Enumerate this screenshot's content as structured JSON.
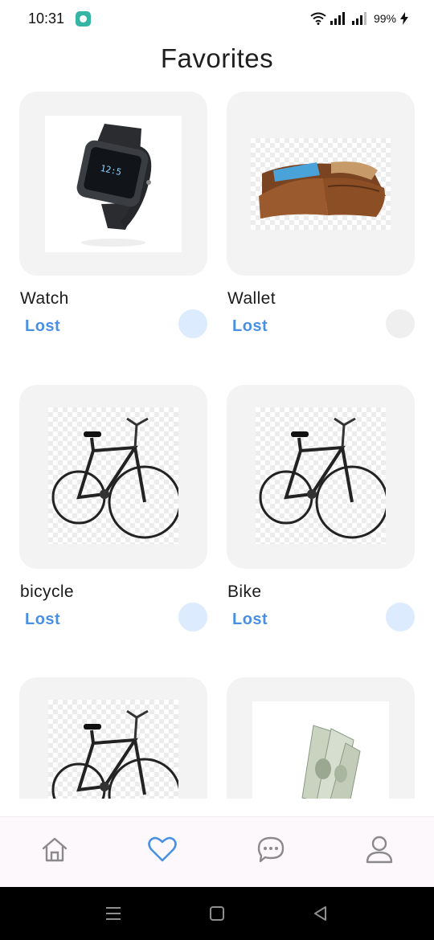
{
  "status_bar": {
    "time": "10:31",
    "battery": "99%"
  },
  "header": {
    "title": "Favorites"
  },
  "items": [
    {
      "name": "Watch",
      "status": "Lost",
      "favorite_state": "on",
      "image": "smartwatch"
    },
    {
      "name": "Wallet",
      "status": "Lost",
      "favorite_state": "off",
      "image": "leather-wallet"
    },
    {
      "name": "bicycle",
      "status": "Lost",
      "favorite_state": "on",
      "image": "bicycle"
    },
    {
      "name": "Bike",
      "status": "Lost",
      "favorite_state": "on",
      "image": "bicycle"
    },
    {
      "name": "",
      "status": "",
      "favorite_state": "",
      "image": "bicycle"
    },
    {
      "name": "",
      "status": "",
      "favorite_state": "",
      "image": "dollar-bills"
    }
  ],
  "bottom_nav": {
    "items": [
      {
        "icon": "home-icon",
        "active": false
      },
      {
        "icon": "heart-icon",
        "active": true
      },
      {
        "icon": "chat-icon",
        "active": false
      },
      {
        "icon": "profile-icon",
        "active": false
      }
    ],
    "active_color": "#4a90e2",
    "inactive_color": "#8a8a8a"
  },
  "system_nav": {
    "buttons": [
      "menu-icon",
      "home-square-icon",
      "back-icon"
    ]
  }
}
